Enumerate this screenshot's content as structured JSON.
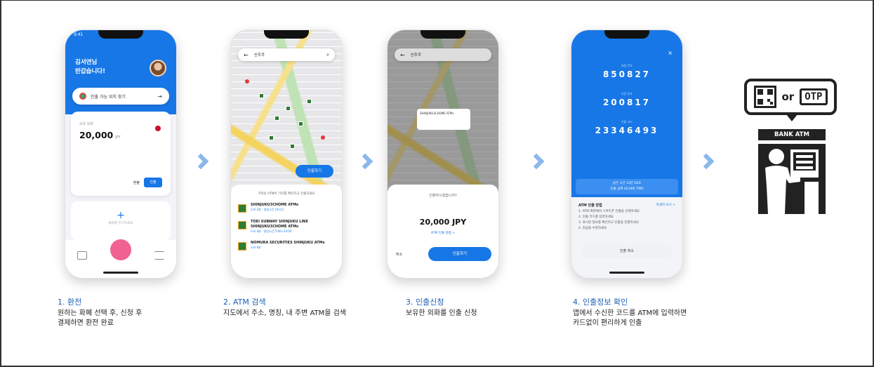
{
  "phone1": {
    "status_time": "9:41",
    "greeting_line1": "김서연님",
    "greeting_line2": "반갑습니다!",
    "find_location": "인출 가능 위치 찾기",
    "balance_label": "보유 외화",
    "amount": "20,000",
    "currency": "JPY",
    "btn_exchange": "환불",
    "btn_withdraw": "인출",
    "add_label": "통화를 추가하세요",
    "tab_left": "내역",
    "tab_center": "환전하기",
    "tab_right": "전체"
  },
  "phone2": {
    "search_text": "신주쿠",
    "withdraw_button": "인출하기",
    "sheet_header": "가까운 ATM이 가치를 확인하고 인출하세요",
    "atms": [
      {
        "name": "SHINJUKU3CHOME ATMs",
        "sub": "도보 2분 · 영업시간 24시간"
      },
      {
        "name": "TOEI SUBWAY SHINJUKU LINE SHINJUKU3CHOME ATMs",
        "sub": "도보 4분 · 영업시간 5:00~24:00"
      },
      {
        "name": "NOMURA SECURITIES SHINJUKU ATMs",
        "sub": "도보 6분"
      }
    ]
  },
  "phone3": {
    "search_text": "신주쿠",
    "map_card": "SHINJUKU3CHOME ATMs",
    "question": "인출하시겠습니까?",
    "amount": "20,000 JPY",
    "link": "ATM 인출 방법 >",
    "cancel": "취소",
    "confirm": "인출하기"
  },
  "phone4": {
    "code1_label": "회원 번호",
    "code1": "850827",
    "code2_label": "인증 번호",
    "code2": "200817",
    "code3_label": "인출 코드",
    "code3": "23346493",
    "info_line1": "남은 시간 14분 56초",
    "info_line2": "인출 금액 20,000 TWD",
    "guide_title": "ATM 인출 방법",
    "guide_link": "자세히 보기 >",
    "guide_lines": [
      "1. ATM 화면에서 스마트폰 인출을 선택하세요",
      "2. 인출 코드를 입력하세요",
      "3. 표시된 정보를 확인하고 인출을 진행하세요",
      "4. 현금을 수령하세요"
    ],
    "cancel_button": "인출 취소"
  },
  "atm": {
    "or_text": "or",
    "otp_text": "OTP",
    "bank_label": "BANK ATM"
  },
  "captions": [
    {
      "title": "1. 환전",
      "line1": "원하는 화폐 선택 후, 신청 후",
      "line2": "결제하면 환전 완료"
    },
    {
      "title": "2. ATM 검색",
      "line1": "지도에서 주소, 명칭, 내 주변 ATM을 검색",
      "line2": ""
    },
    {
      "title": "3. 인출신청",
      "line1": "보유한 외화를 인출 신청",
      "line2": ""
    },
    {
      "title": "4. 인출정보 확인",
      "line1": "앱에서 수신한 코드를 ATM에 입력하면",
      "line2": "카드없이 편리하게 인출"
    }
  ],
  "colors": {
    "accent": "#1877e6",
    "caption_title": "#1c5fb8",
    "chevron": "#8ab8ec"
  }
}
